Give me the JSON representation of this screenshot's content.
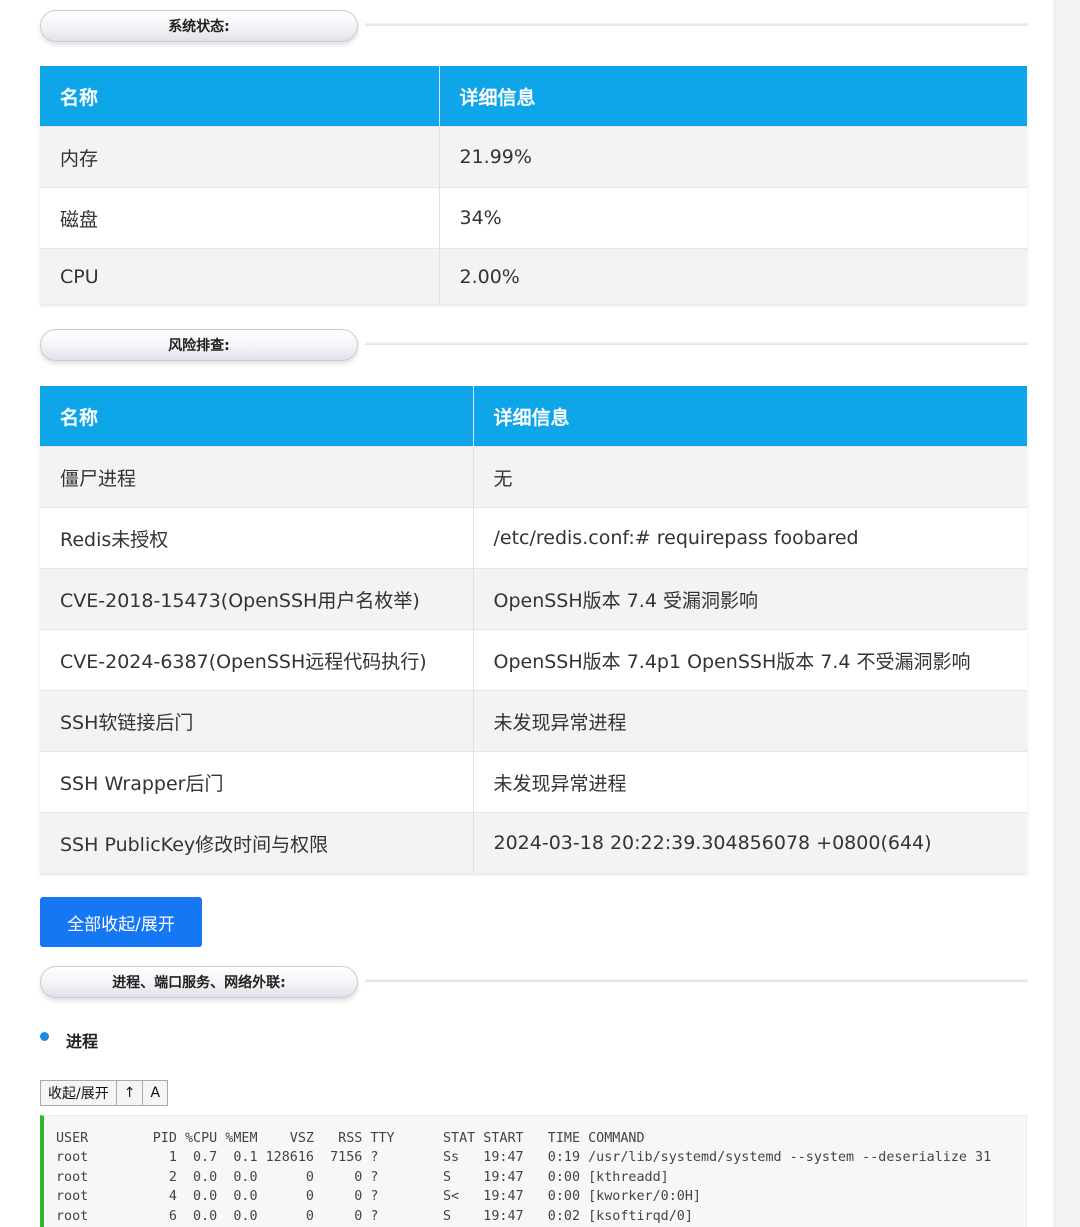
{
  "system_status": {
    "title": "系统状态:",
    "headers": [
      "名称",
      "详细信息"
    ],
    "rows": [
      [
        "内存",
        "21.99%"
      ],
      [
        "磁盘",
        "34%"
      ],
      [
        "CPU",
        "2.00%"
      ]
    ]
  },
  "risk_check": {
    "title": "风险排查:",
    "headers": [
      "名称",
      "详细信息"
    ],
    "rows": [
      [
        "僵尸进程",
        "无"
      ],
      [
        "Redis未授权",
        "/etc/redis.conf:# requirepass foobared"
      ],
      [
        "CVE-2018-15473(OpenSSH用户名枚举)",
        "OpenSSH版本 7.4 受漏洞影响"
      ],
      [
        "CVE-2024-6387(OpenSSH远程代码执行)",
        "OpenSSH版本 7.4p1 OpenSSH版本 7.4 不受漏洞影响"
      ],
      [
        "SSH软链接后门",
        "未发现异常进程"
      ],
      [
        "SSH Wrapper后门",
        "未发现异常进程"
      ],
      [
        "SSH PublicKey修改时间与权限",
        "2024-03-18 20:22:39.304856078 +0800(644)"
      ]
    ]
  },
  "toggle_all_label": "全部收起/展开",
  "process_section": {
    "title": "进程、端口服务、网络外联:",
    "subtitle": "进程",
    "toolbar": {
      "toggle": "收起/展开",
      "up": "↑",
      "font": "A"
    },
    "ps_output": [
      "USER        PID %CPU %MEM    VSZ   RSS TTY      STAT START   TIME COMMAND",
      "root          1  0.7  0.1 128616  7156 ?        Ss   19:47   0:19 /usr/lib/systemd/systemd --system --deserialize 31",
      "root          2  0.0  0.0      0     0 ?        S    19:47   0:00 [kthreadd]",
      "root          4  0.0  0.0      0     0 ?        S<   19:47   0:00 [kworker/0:0H]",
      "root          6  0.0  0.0      0     0 ?        S    19:47   0:02 [ksoftirqd/0]"
    ]
  },
  "colors": {
    "table_header": "#0ea6e8",
    "primary_button": "#1677f2",
    "code_accent": "#2eb82e"
  }
}
